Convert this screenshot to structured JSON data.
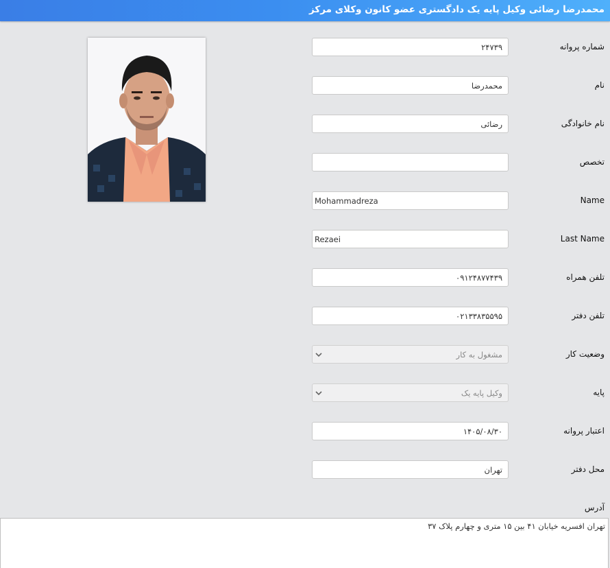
{
  "header": {
    "title": "محمدرضا رضائی وکیل پایه یک دادگستری عضو کانون وکلای مرکز"
  },
  "colors": {
    "header_start": "#3a7ee6",
    "header_end": "#4fb0fb",
    "background": "#e5e6e8"
  },
  "form": {
    "license_number": {
      "label": "شماره پروانه",
      "value": "۲۴۷۳۹"
    },
    "first_name": {
      "label": "نام",
      "value": "محمدرضا"
    },
    "last_name_fa": {
      "label": "نام خانوادگی",
      "value": "رضائی"
    },
    "specialty": {
      "label": "تخصص",
      "value": ""
    },
    "name_en": {
      "label": "Name",
      "value": "Mohammadreza"
    },
    "last_name_en": {
      "label": "Last Name",
      "value": "Rezaei"
    },
    "mobile": {
      "label": "تلفن همراه",
      "value": "۰۹۱۲۴۸۷۷۴۳۹"
    },
    "office_phone": {
      "label": "تلفن دفتر",
      "value": "۰۲۱۳۳۸۳۵۵۹۵"
    },
    "work_status": {
      "label": "وضعیت کار",
      "value": "مشغول به کار",
      "icon": "chevron-down-icon"
    },
    "grade": {
      "label": "پایه",
      "value": "وکیل پایه یک",
      "icon": "chevron-down-icon"
    },
    "license_validity": {
      "label": "اعتبار پروانه",
      "value": "۱۴۰۵/۰۸/۳۰"
    },
    "office_location": {
      "label": "محل دفتر",
      "value": "تهران"
    },
    "address": {
      "label": "آدرس",
      "value": "تهران افسریه خیابان ۴۱ بین ۱۵ متری و چهارم پلاک ۳۷"
    }
  }
}
